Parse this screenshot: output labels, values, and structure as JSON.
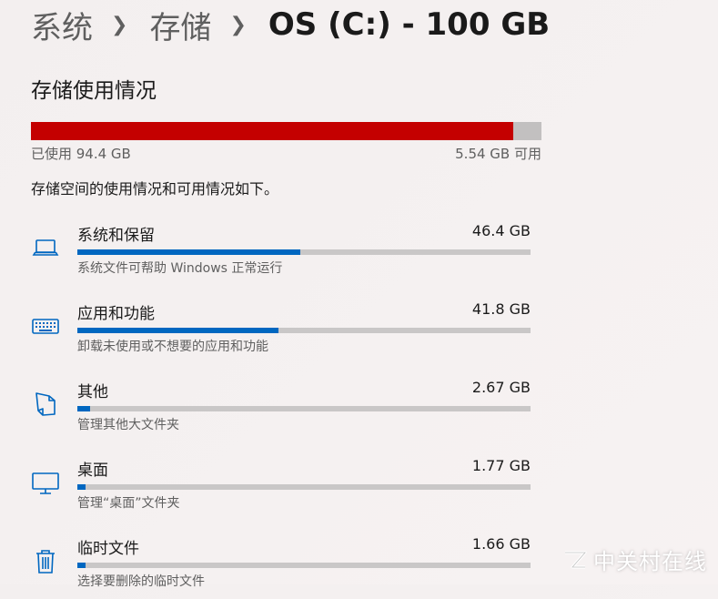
{
  "breadcrumb": {
    "items": [
      "系统",
      "存储"
    ],
    "current": "OS (C:) - 100 GB"
  },
  "storage": {
    "title": "存储使用情况",
    "used_label": "已使用 94.4 GB",
    "free_label": "5.54 GB 可用",
    "used_fraction": 0.944,
    "description": "存储空间的使用情况和可用情况如下。"
  },
  "categories": [
    {
      "icon": "laptop-icon",
      "name": "系统和保留",
      "size": "46.4 GB",
      "subtitle": "系统文件可帮助 Windows 正常运行",
      "fraction": 0.492
    },
    {
      "icon": "keyboard-icon",
      "name": "应用和功能",
      "size": "41.8 GB",
      "subtitle": "卸载未使用或不想要的应用和功能",
      "fraction": 0.443
    },
    {
      "icon": "document-icon",
      "name": "其他",
      "size": "2.67 GB",
      "subtitle": "管理其他大文件夹",
      "fraction": 0.028
    },
    {
      "icon": "monitor-icon",
      "name": "桌面",
      "size": "1.77 GB",
      "subtitle": "管理“桌面”文件夹",
      "fraction": 0.019
    },
    {
      "icon": "trash-icon",
      "name": "临时文件",
      "size": "1.66 GB",
      "subtitle": "选择要删除的临时文件",
      "fraction": 0.018
    }
  ],
  "colors": {
    "used": "#c40000",
    "category_fill": "#0067c0",
    "track": "#c9c7c7"
  },
  "watermark": {
    "text": "中关村在线"
  }
}
